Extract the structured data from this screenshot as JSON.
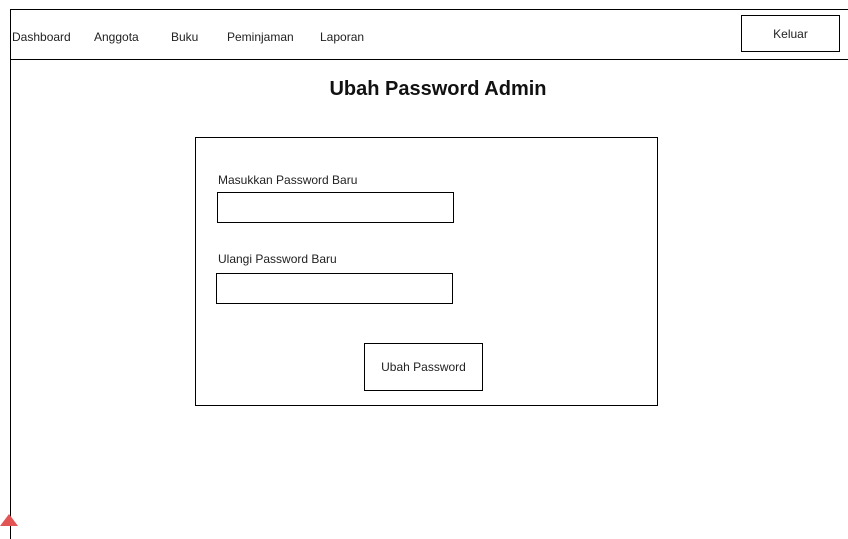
{
  "navbar": {
    "items": [
      {
        "label": "Dashboard"
      },
      {
        "label": "Anggota"
      },
      {
        "label": "Buku"
      },
      {
        "label": "Peminjaman"
      },
      {
        "label": "Laporan"
      }
    ],
    "logout_label": "Keluar"
  },
  "page": {
    "title": "Ubah Password Admin"
  },
  "form": {
    "new_password_label": "Masukkan Password Baru",
    "new_password_value": "",
    "repeat_password_label": "Ulangi Password Baru",
    "repeat_password_value": "",
    "submit_label": "Ubah Password"
  },
  "colors": {
    "border": "#000000",
    "background": "#ffffff",
    "corner_mark": "#e35454"
  }
}
